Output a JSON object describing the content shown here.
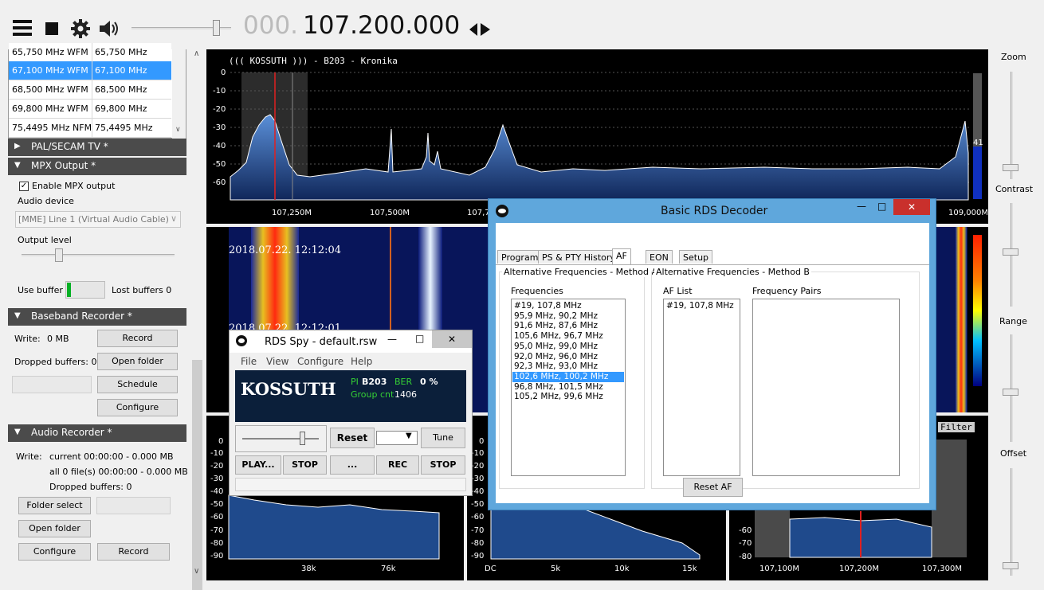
{
  "toolbar": {
    "frequency_prefix": "000.",
    "frequency_main": "107.200.000",
    "icons": [
      "menu-icon",
      "stop-icon",
      "gear-icon",
      "speaker-icon",
      "tune-arrows-icon"
    ]
  },
  "freq_list": [
    {
      "name": "65,750 MHz WFM",
      "freq": "65,750 MHz"
    },
    {
      "name": "67,100 MHz WFM",
      "freq": "67,100 MHz",
      "selected": true
    },
    {
      "name": "68,500 MHz WFM",
      "freq": "68,500 MHz"
    },
    {
      "name": "69,800 MHz WFM",
      "freq": "69,800 MHz"
    },
    {
      "name": "75,4495 MHz NFM",
      "freq": "75,4495 MHz"
    }
  ],
  "sections": {
    "pal": "PAL/SECAM TV *",
    "mpx": "MPX Output *",
    "baseband": "Baseband Recorder *",
    "audio": "Audio Recorder *"
  },
  "mpx": {
    "enable_label": "Enable MPX output",
    "enabled": true,
    "audio_device_label": "Audio device",
    "audio_device_value": "[MME] Line 1 (Virtual Audio Cable)",
    "output_level_label": "Output level",
    "output_level": 0.22,
    "use_buffer_label": "Use buffer",
    "lost_buffers": "Lost buffers 0"
  },
  "baseband": {
    "write": "Write:",
    "write_val": "0 MB",
    "dropped": "Dropped buffers: 0",
    "record": "Record",
    "open_folder": "Open folder",
    "schedule": "Schedule",
    "configure": "Configure"
  },
  "audio": {
    "write": "Write:",
    "current": "current 00:00:00 - 0.000 MB",
    "all": "all 0 file(s) 00:00:00 - 0.000 MB",
    "dropped": "Dropped buffers: 0",
    "folder_select": "Folder select",
    "open_folder": "Open folder",
    "configure": "Configure",
    "record": "Record"
  },
  "spectrum": {
    "title": "((( KOSSUTH ))) - B203 - Kronika",
    "y_ticks": [
      "0",
      "-10",
      "-20",
      "-30",
      "-40",
      "-50",
      "-60"
    ],
    "x_ticks": [
      "107,250M",
      "107,500M",
      "107,7",
      "109,000M"
    ],
    "level_badge": "41"
  },
  "waterfall": {
    "ts1": "2018.07.22. 12:12:04",
    "ts2": "2018.07.22. 12:12:01"
  },
  "bottom_left": {
    "y_ticks": [
      "0",
      "-10",
      "-20",
      "-30",
      "-40",
      "-50",
      "-60",
      "-70",
      "-80",
      "-90"
    ],
    "x_ticks": [
      "38k",
      "76k"
    ]
  },
  "bottom_mid": {
    "y_ticks": [
      "0",
      "-10",
      "-20",
      "-30",
      "-40",
      "-50",
      "-60",
      "-70",
      "-80",
      "-90"
    ],
    "x_ticks": [
      "DC",
      "5k",
      "10k",
      "15k"
    ]
  },
  "bottom_right": {
    "y_ticks": [
      "-60",
      "-70",
      "-80"
    ],
    "x_ticks": [
      "107,100M",
      "107,200M",
      "107,300M"
    ],
    "filter": "Filter"
  },
  "right_sliders": {
    "zoom": "Zoom",
    "contrast": "Contrast",
    "range": "Range",
    "offset": "Offset"
  },
  "rds_spy": {
    "title": "RDS Spy - default.rsw",
    "menu": [
      "File",
      "View",
      "Configure",
      "Help"
    ],
    "ps": "KOSSUTH",
    "pi_label": "PI",
    "pi": "B203",
    "ber_label": "BER",
    "ber": "0 %",
    "group_label": "Group cnt",
    "group_cnt": "1406",
    "reset": "Reset",
    "tune": "Tune",
    "play": "PLAY...",
    "stop": "STOP",
    "dots": "...",
    "rec": "REC",
    "stop2": "STOP"
  },
  "rds_decoder": {
    "title": "Basic RDS Decoder",
    "tabs": [
      "Program",
      "PS & PTY History",
      "AF",
      "EON",
      "Setup"
    ],
    "active_tab": "AF",
    "method_a": "Alternative Frequencies - Method A",
    "method_b": "Alternative Frequencies - Method B",
    "frequencies_label": "Frequencies",
    "af_list_label": "AF List",
    "pairs_label": "Frequency Pairs",
    "frequencies": [
      "#19, 107,8 MHz",
      "95,9 MHz, 90,2 MHz",
      "91,6 MHz, 87,6 MHz",
      "105,6 MHz, 96,7 MHz",
      "95,0 MHz, 99,0 MHz",
      "92,0 MHz, 96,0 MHz",
      "92,3 MHz, 93,0 MHz",
      "102,6 MHz, 100,2 MHz",
      "96,8 MHz, 101,5 MHz",
      "105,2 MHz, 99,6 MHz"
    ],
    "selected_index": 7,
    "af_list": [
      "#19, 107,8 MHz"
    ],
    "reset_af": "Reset AF"
  },
  "colors": {
    "spectrum_fill": "#1f4a8c",
    "accent": "#3399ff",
    "window_frame": "#5fa7dc",
    "close_red": "#c9302c"
  }
}
